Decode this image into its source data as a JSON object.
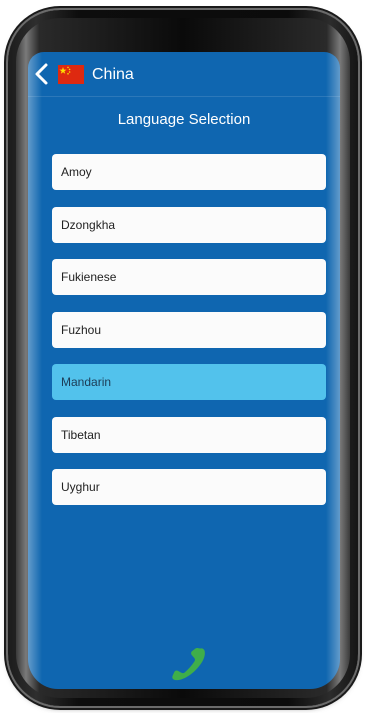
{
  "header": {
    "country": "China",
    "title": "Language Selection"
  },
  "languages": [
    {
      "label": "Amoy",
      "selected": false
    },
    {
      "label": "Dzongkha",
      "selected": false
    },
    {
      "label": "Fukienese",
      "selected": false
    },
    {
      "label": "Fuzhou",
      "selected": false
    },
    {
      "label": "Mandarin",
      "selected": true
    },
    {
      "label": "Tibetan",
      "selected": false
    },
    {
      "label": "Uyghur",
      "selected": false
    }
  ],
  "icons": {
    "back": "chevron-left-icon",
    "flag": "china-flag-icon",
    "call": "phone-icon"
  },
  "colors": {
    "screen_bg": "#0f66b0",
    "item_bg": "#fbfbfb",
    "selected_bg": "#52c2ec",
    "call_green": "#3fae4a"
  }
}
